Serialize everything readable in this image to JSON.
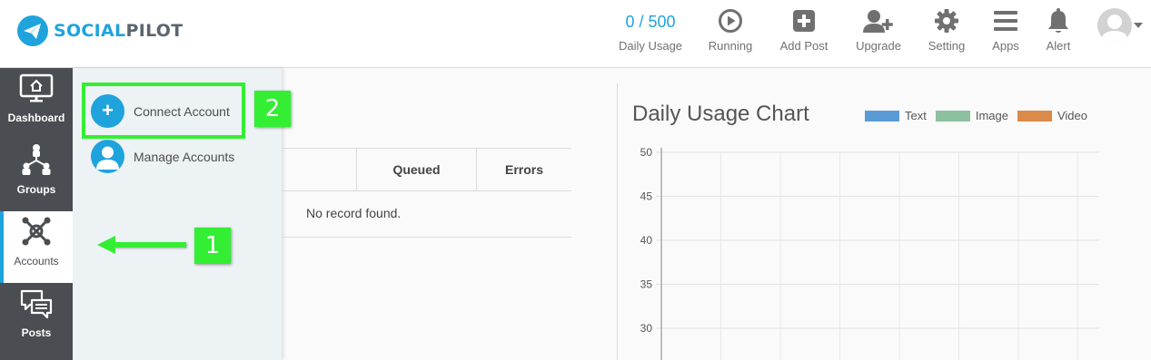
{
  "logo": {
    "part1": "SOCIAL",
    "part2": "PILOT"
  },
  "header": {
    "usage_count": "0 / 500",
    "usage_label": "Daily Usage",
    "nav": [
      {
        "label": "Running",
        "icon": "play-circle-icon"
      },
      {
        "label": "Add Post",
        "icon": "plus-square-icon"
      },
      {
        "label": "Upgrade",
        "icon": "user-plus-icon"
      },
      {
        "label": "Setting",
        "icon": "gear-icon"
      },
      {
        "label": "Apps",
        "icon": "hamburger-icon"
      },
      {
        "label": "Alert",
        "icon": "bell-icon"
      }
    ]
  },
  "sidebar": {
    "items": [
      {
        "label": "Dashboard",
        "icon": "monitor-home-icon"
      },
      {
        "label": "Groups",
        "icon": "hierarchy-icon"
      },
      {
        "label": "Accounts",
        "icon": "network-icon",
        "active": true
      },
      {
        "label": "Posts",
        "icon": "chat-bubbles-icon"
      }
    ]
  },
  "flyout": {
    "items": [
      {
        "label": "Connect Account",
        "icon": "plus-icon"
      },
      {
        "label": "Manage Accounts",
        "icon": "user-icon"
      }
    ]
  },
  "table": {
    "columns": [
      "Queued",
      "Errors"
    ],
    "empty_message": "No record found."
  },
  "chart_title": "Daily Usage Chart",
  "annotations": {
    "badge1": "1",
    "badge2": "2"
  },
  "chart_data": {
    "type": "bar",
    "title": "Daily Usage Chart",
    "series": [
      {
        "name": "Text",
        "color": "#5b9bd5",
        "values": []
      },
      {
        "name": "Image",
        "color": "#8cc09f",
        "values": []
      },
      {
        "name": "Video",
        "color": "#dc8a4a",
        "values": []
      }
    ],
    "y_ticks": [
      50,
      45,
      40,
      35,
      30
    ],
    "ylim": [
      30,
      50
    ],
    "grid": true,
    "legend": "top-right"
  }
}
